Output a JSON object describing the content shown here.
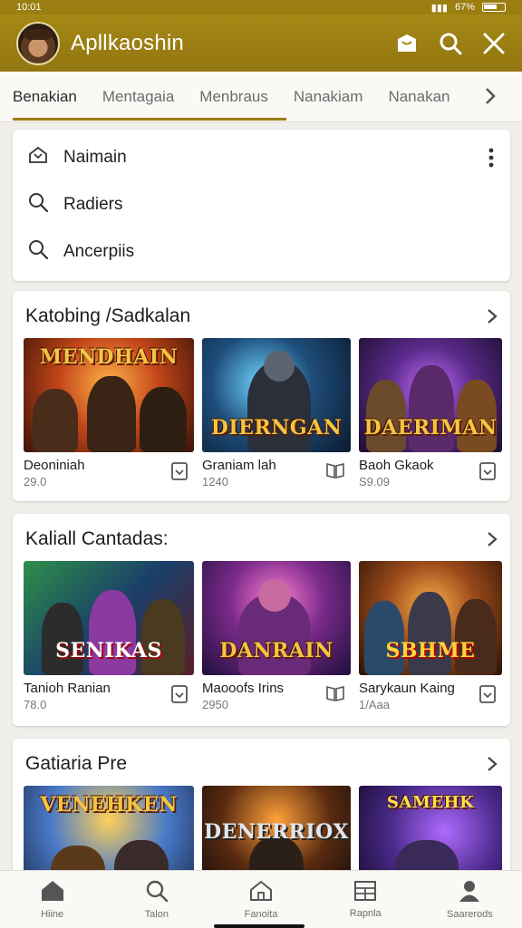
{
  "status": {
    "time": "10:01",
    "battery": "67%"
  },
  "app": {
    "title": "Apllkaoshin",
    "icons": [
      "avatar",
      "store-icon",
      "search-icon",
      "close-icon"
    ]
  },
  "tabs": [
    {
      "label": "Benakian",
      "active": true
    },
    {
      "label": "Mentagaia",
      "active": false
    },
    {
      "label": "Menbraus",
      "active": false
    },
    {
      "label": "Nanakiam",
      "active": false
    },
    {
      "label": "Nanakan",
      "active": false
    }
  ],
  "search_panel": {
    "items": [
      {
        "label": "Naimain",
        "icon": "home-outline-icon"
      },
      {
        "label": "Radiers",
        "icon": "search-icon"
      },
      {
        "label": "Ancerpiis",
        "icon": "search-icon"
      }
    ]
  },
  "sections": [
    {
      "title": "Katobing /Sadkalan",
      "games": [
        {
          "name": "Deoniniah",
          "size": "29.0"
        },
        {
          "name": "Graniam lah",
          "size": "1240"
        },
        {
          "name": "Baoh Gkaok",
          "size": "S9.09"
        }
      ]
    },
    {
      "title": "Kaliall Cantadas:",
      "games": [
        {
          "name": "Tanioh Ranian",
          "size": "78.0"
        },
        {
          "name": "Maooofs Irins",
          "size": "2950"
        },
        {
          "name": "Sarykaun Kaing",
          "size": "1/Aaa"
        }
      ]
    },
    {
      "title": "Gatiaria Pre",
      "games": [
        {
          "name": "",
          "size": ""
        },
        {
          "name": "",
          "size": ""
        },
        {
          "name": "",
          "size": ""
        }
      ]
    }
  ],
  "thumb_logos": [
    "MENDHAIN",
    "DIERNGAN",
    "DAERIMAN",
    "SENIKAS",
    "DANRAIN",
    "SBHME",
    "VENEHKEN",
    "DENERRIOX",
    "SAMEHK"
  ],
  "bottom_nav": [
    {
      "label": "Hiine",
      "icon": "home-icon"
    },
    {
      "label": "Talon",
      "icon": "search-icon"
    },
    {
      "label": "Fanoita",
      "icon": "house-outline-icon"
    },
    {
      "label": "Rapnla",
      "icon": "grid-icon"
    },
    {
      "label": "Saarerods",
      "icon": "person-icon"
    }
  ],
  "colors": {
    "accent": "#9b7e12",
    "appbar": "#a48815",
    "background": "#f1efe9"
  }
}
